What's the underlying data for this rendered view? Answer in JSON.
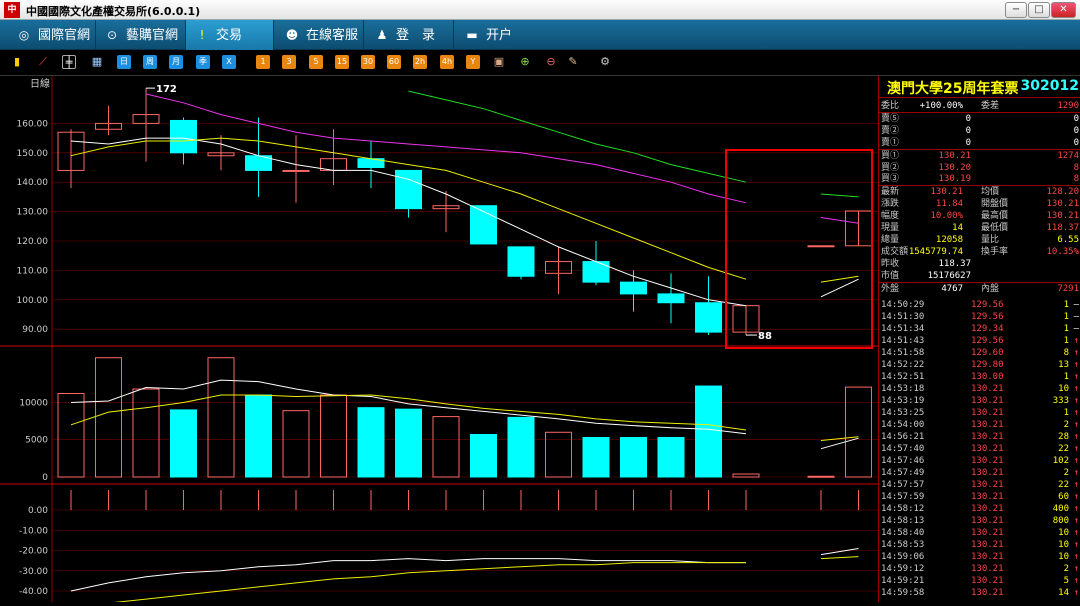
{
  "window": {
    "title": "中國國際文化產權交易所(6.0.0.1)",
    "icon": "app-logo"
  },
  "nav": [
    {
      "label": "國際官網",
      "icon": "globe-icon",
      "active": false
    },
    {
      "label": "藝購官網",
      "icon": "link-icon",
      "active": false
    },
    {
      "label": "交易",
      "icon": "trade-icon",
      "active": true
    },
    {
      "label": "在線客服",
      "icon": "chat-icon",
      "active": false
    },
    {
      "label": "登　录",
      "icon": "user-icon",
      "active": false
    },
    {
      "label": "开户",
      "icon": "card-icon",
      "active": false
    }
  ],
  "toolbar": {
    "period_buttons": [
      "日",
      "周",
      "月",
      "季",
      "X"
    ],
    "minute_buttons": [
      "1",
      "3",
      "5",
      "15",
      "30",
      "60",
      "2h",
      "4h",
      "Y"
    ]
  },
  "chart": {
    "period_label": "日線",
    "price_ticks": [
      "160.00",
      "150.00",
      "140.00",
      "130.00",
      "120.00",
      "110.00",
      "100.00",
      "90.00"
    ],
    "volume_ticks": [
      "10000",
      "5000",
      "0"
    ],
    "macd_ticks": [
      "0.00",
      "-10.00",
      "-20.00",
      "-30.00",
      "-40.00"
    ],
    "high_label": "172",
    "low_label": "88"
  },
  "chart_data": {
    "type": "candlestick",
    "ylim": [
      85,
      175
    ],
    "candles": [
      {
        "o": 144,
        "c": 157,
        "h": 158,
        "l": 138
      },
      {
        "o": 158,
        "c": 160,
        "h": 166,
        "l": 156
      },
      {
        "o": 160,
        "c": 163,
        "h": 172,
        "l": 147
      },
      {
        "o": 161,
        "c": 150,
        "h": 162,
        "l": 146
      },
      {
        "o": 149,
        "c": 150,
        "h": 156,
        "l": 144
      },
      {
        "o": 149,
        "c": 144,
        "h": 162,
        "l": 135
      },
      {
        "o": 144,
        "c": 144,
        "h": 156,
        "l": 133
      },
      {
        "o": 144,
        "c": 148,
        "h": 158,
        "l": 139
      },
      {
        "o": 148,
        "c": 145,
        "h": 154,
        "l": 138
      },
      {
        "o": 144,
        "c": 131,
        "h": 144,
        "l": 128
      },
      {
        "o": 131,
        "c": 132,
        "h": 137,
        "l": 123
      },
      {
        "o": 132,
        "c": 119,
        "h": 132,
        "l": 119
      },
      {
        "o": 118,
        "c": 108,
        "h": 118,
        "l": 107
      },
      {
        "o": 109,
        "c": 113,
        "h": 118,
        "l": 102
      },
      {
        "o": 113,
        "c": 106,
        "h": 120,
        "l": 105
      },
      {
        "o": 106,
        "c": 102,
        "h": 110,
        "l": 96
      },
      {
        "o": 102,
        "c": 99,
        "h": 109,
        "l": 92
      },
      {
        "o": 99,
        "c": 89,
        "h": 108,
        "l": 88
      },
      {
        "o": 89,
        "c": 98,
        "h": 98,
        "l": 88
      },
      {
        "o": null,
        "c": null,
        "h": null,
        "l": null
      },
      {
        "o": 118.37,
        "c": 118.37,
        "h": 118.37,
        "l": 118.37
      },
      {
        "o": 118.37,
        "c": 130.21,
        "h": 130.21,
        "l": 118.37
      }
    ],
    "volumes": [
      11200,
      16000,
      11800,
      9000,
      16000,
      11000,
      8900,
      11000,
      9300,
      9100,
      8100,
      5700,
      8000,
      6000,
      5300,
      5300,
      5300,
      12200,
      400,
      400,
      100,
      12058
    ],
    "ma_price_white": [
      154,
      153,
      155,
      155,
      153,
      149,
      146,
      144,
      144,
      141,
      136,
      130,
      124,
      118,
      113,
      108,
      104,
      100,
      98,
      null,
      101,
      107
    ],
    "ma_price_yellow": [
      149,
      152,
      154,
      154,
      155,
      154,
      152,
      150,
      148,
      146,
      144,
      140,
      136,
      131,
      126,
      121,
      116,
      111,
      107,
      null,
      106,
      108
    ],
    "ma_price_magenta": [
      null,
      null,
      170,
      167,
      163,
      160,
      157,
      155,
      154,
      153,
      152,
      151,
      150,
      148,
      146,
      143,
      140,
      136,
      133,
      null,
      128,
      126
    ],
    "ma_price_green": [
      null,
      null,
      null,
      null,
      null,
      null,
      null,
      null,
      null,
      171,
      168,
      165,
      161,
      157,
      153,
      150,
      146,
      143,
      140,
      null,
      136,
      135
    ],
    "ma_vol_white": [
      10000,
      10200,
      12000,
      11800,
      13000,
      12800,
      11800,
      11000,
      10800,
      9800,
      9300,
      8800,
      8300,
      7800,
      7200,
      6900,
      6600,
      6400,
      5800,
      null,
      3800,
      5200
    ],
    "ma_vol_yellow": [
      7000,
      8700,
      9300,
      10000,
      11000,
      11000,
      10800,
      10900,
      11000,
      10500,
      9800,
      9200,
      8800,
      8400,
      7800,
      7400,
      7200,
      7000,
      6300,
      null,
      4900,
      5400
    ],
    "macd_white": [
      -40,
      -36,
      -33,
      -31,
      -30,
      -28,
      -27,
      -25,
      -25,
      -24,
      -25,
      -24,
      -24,
      -24,
      -25,
      -25,
      -25,
      -26,
      -26,
      null,
      -22,
      -19
    ],
    "macd_yellow": [
      -49,
      -46,
      -44,
      -42,
      -40,
      -38,
      -36,
      -34,
      -33,
      -31,
      -30,
      -29,
      -28,
      -27,
      -27,
      -26,
      -26,
      -26,
      -26,
      null,
      -24,
      -23
    ]
  },
  "panel": {
    "name": "澳門大學25周年套票",
    "code": "302012",
    "rows_top": [
      {
        "l": "委比",
        "v": "+100.00%",
        "l2": "委差",
        "v2": "1290"
      },
      {
        "l": "賣⑤",
        "v": "0",
        "v2": "0"
      },
      {
        "l": "賣②",
        "v": "0",
        "v2": "0"
      },
      {
        "l": "賣①",
        "v": "0",
        "v2": "0"
      },
      {
        "l": "買①",
        "v": "130.21",
        "v2": "1274"
      },
      {
        "l": "買②",
        "v": "130.20",
        "v2": "8"
      },
      {
        "l": "買③",
        "v": "130.19",
        "v2": "8"
      },
      {
        "l": "最新",
        "v": "130.21",
        "l2": "均價",
        "v2": "128.20"
      },
      {
        "l": "漲跌",
        "v": "11.84",
        "l2": "開盤價",
        "v2": "130.21"
      },
      {
        "l": "幅度",
        "v": "10.00%",
        "l2": "最高價",
        "v2": "130.21"
      },
      {
        "l": "現量",
        "v": "14",
        "l2": "最低價",
        "v2": "118.37"
      },
      {
        "l": "總量",
        "v": "12058",
        "l2": "量比",
        "v2": "6.55"
      },
      {
        "l": "成交額",
        "v": "1545779.74",
        "l2": "換手率",
        "v2": "10.35%"
      },
      {
        "l": "昨收",
        "v": "118.37"
      },
      {
        "l": "市值",
        "v": "15176627"
      },
      {
        "l": "外盤",
        "v": "4767",
        "l2": "內盤",
        "v2": "7291"
      }
    ],
    "ticks": [
      {
        "t": "14:50:29",
        "p": "129.56",
        "q": "1",
        "a": "—"
      },
      {
        "t": "14:51:30",
        "p": "129.56",
        "q": "1",
        "a": "—"
      },
      {
        "t": "14:51:34",
        "p": "129.34",
        "q": "1",
        "a": "—"
      },
      {
        "t": "14:51:43",
        "p": "129.56",
        "q": "1",
        "a": "↑"
      },
      {
        "t": "14:51:58",
        "p": "129.60",
        "q": "8",
        "a": "↑"
      },
      {
        "t": "14:52:22",
        "p": "129.80",
        "q": "13",
        "a": "↑"
      },
      {
        "t": "14:52:51",
        "p": "130.00",
        "q": "1",
        "a": "↑"
      },
      {
        "t": "14:53:18",
        "p": "130.21",
        "q": "10",
        "a": "↑"
      },
      {
        "t": "14:53:19",
        "p": "130.21",
        "q": "333",
        "a": "↑"
      },
      {
        "t": "14:53:25",
        "p": "130.21",
        "q": "1",
        "a": "↑"
      },
      {
        "t": "14:54:00",
        "p": "130.21",
        "q": "2",
        "a": "↑"
      },
      {
        "t": "14:56:21",
        "p": "130.21",
        "q": "28",
        "a": "↑"
      },
      {
        "t": "14:57:40",
        "p": "130.21",
        "q": "22",
        "a": "↑"
      },
      {
        "t": "14:57:46",
        "p": "130.21",
        "q": "102",
        "a": "↑"
      },
      {
        "t": "14:57:49",
        "p": "130.21",
        "q": "2",
        "a": "↑"
      },
      {
        "t": "14:57:57",
        "p": "130.21",
        "q": "22",
        "a": "↑"
      },
      {
        "t": "14:57:59",
        "p": "130.21",
        "q": "60",
        "a": "↑"
      },
      {
        "t": "14:58:12",
        "p": "130.21",
        "q": "400",
        "a": "↑"
      },
      {
        "t": "14:58:13",
        "p": "130.21",
        "q": "800",
        "a": "↑"
      },
      {
        "t": "14:58:40",
        "p": "130.21",
        "q": "10",
        "a": "↑"
      },
      {
        "t": "14:58:53",
        "p": "130.21",
        "q": "10",
        "a": "↑"
      },
      {
        "t": "14:59:06",
        "p": "130.21",
        "q": "10",
        "a": "↑"
      },
      {
        "t": "14:59:12",
        "p": "130.21",
        "q": "2",
        "a": "↑"
      },
      {
        "t": "14:59:21",
        "p": "130.21",
        "q": "5",
        "a": "↑"
      },
      {
        "t": "14:59:58",
        "p": "130.21",
        "q": "14",
        "a": "↑"
      }
    ]
  }
}
